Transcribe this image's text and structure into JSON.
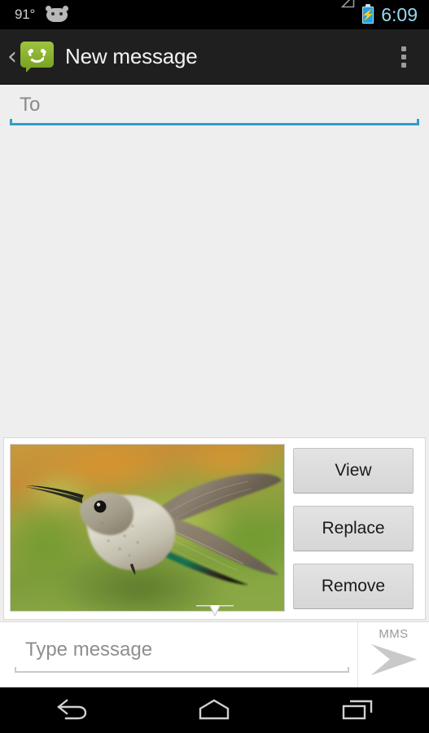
{
  "status_bar": {
    "temperature": "91°",
    "android_icon": "android-face-icon",
    "signal_icon": "signal-triangle-icon",
    "battery_icon": "battery-charging-icon",
    "clock": "6:09",
    "clock_color": "#99d9f0",
    "battery_color": "#2a9fd6",
    "background": "#000000"
  },
  "action_bar": {
    "back_label": "‹",
    "app_icon": "messaging-bubble-icon",
    "title": "New message",
    "overflow_icon": "overflow-menu-icon",
    "background": "#1f1f1f",
    "accent": "#8cb530"
  },
  "recipients": {
    "placeholder": "To",
    "value": "",
    "underline_color": "#2f9fc8"
  },
  "attachment": {
    "media_type": "image",
    "thumbnail_alt": "hummingbird-photo",
    "buttons": [
      {
        "label": "View",
        "name": "view-attachment-button"
      },
      {
        "label": "Replace",
        "name": "replace-attachment-button"
      },
      {
        "label": "Remove",
        "name": "remove-attachment-button"
      }
    ],
    "caret_icon": "chevron-down-icon",
    "panel_background": "#ffffff"
  },
  "compose": {
    "placeholder": "Type message",
    "value": "",
    "message_type_label": "MMS",
    "send_icon": "send-arrow-icon",
    "send_icon_color": "#c4c4c4"
  },
  "nav_bar": {
    "back_icon": "nav-back-icon",
    "home_icon": "nav-home-icon",
    "recents_icon": "nav-recents-icon",
    "background": "#000000"
  }
}
